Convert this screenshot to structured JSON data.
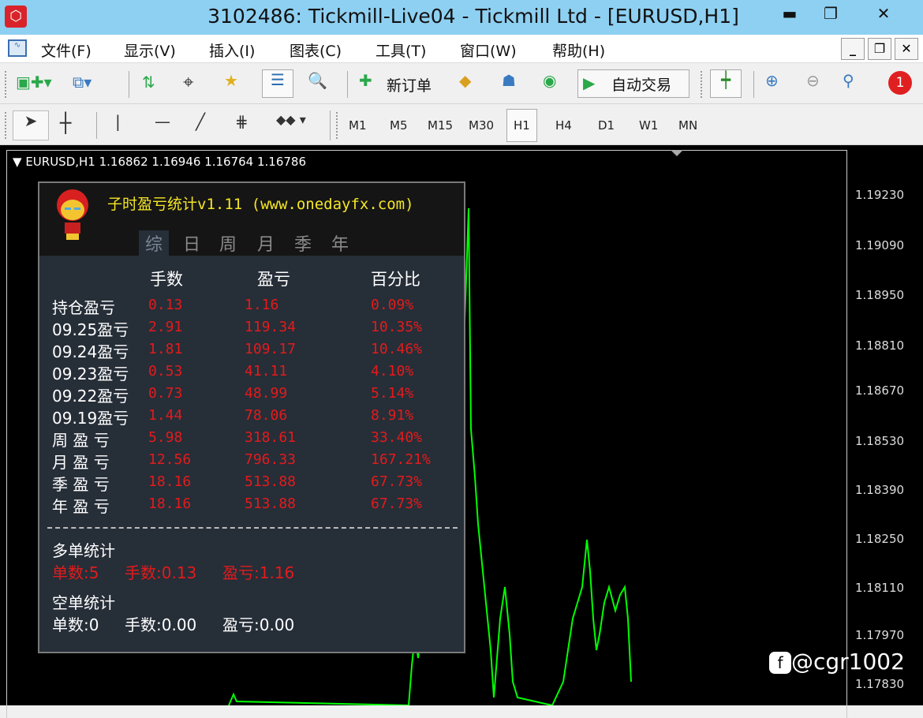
{
  "window": {
    "title": "3102486: Tickmill-Live04 - Tickmill Ltd - [EURUSD,H1]",
    "minimize": "▬",
    "maximize": "❐",
    "close": "✕"
  },
  "menu": [
    "文件(F)",
    "显示(V)",
    "插入(I)",
    "图表(C)",
    "工具(T)",
    "窗口(W)",
    "帮助(H)"
  ],
  "toolbar": {
    "new_order": "新订单",
    "auto_trading": "自动交易",
    "notification_count": "1"
  },
  "timeframes": [
    "M1",
    "M5",
    "M15",
    "M30",
    "H1",
    "H4",
    "D1",
    "W1",
    "MN"
  ],
  "active_timeframe": "H1",
  "chart": {
    "header": "EURUSD,H1  1.16862 1.16946 1.16764 1.16786",
    "price_labels": [
      "1.19230",
      "1.19090",
      "1.18950",
      "1.18810",
      "1.18670",
      "1.18530",
      "1.18390",
      "1.18250",
      "1.18110",
      "1.17970",
      "1.17830"
    ],
    "line_color": "#00ff00"
  },
  "panel": {
    "title": "子时盈亏统计v1.11 (www.onedayfx.com)",
    "tabs": [
      "综",
      "日",
      "周",
      "月",
      "季",
      "年"
    ],
    "columns": [
      "手数",
      "盈亏",
      "百分比"
    ],
    "rows": [
      {
        "label": "持仓盈亏",
        "lots": "0.13",
        "pl": "1.16",
        "pct": "0.09%"
      },
      {
        "label": "09.25盈亏",
        "lots": "2.91",
        "pl": "119.34",
        "pct": "10.35%"
      },
      {
        "label": "09.24盈亏",
        "lots": "1.81",
        "pl": "109.17",
        "pct": "10.46%"
      },
      {
        "label": "09.23盈亏",
        "lots": "0.53",
        "pl": "41.11",
        "pct": "4.10%"
      },
      {
        "label": "09.22盈亏",
        "lots": "0.73",
        "pl": "48.99",
        "pct": "5.14%"
      },
      {
        "label": "09.19盈亏",
        "lots": "1.44",
        "pl": "78.06",
        "pct": "8.91%"
      },
      {
        "label": "周 盈 亏",
        "lots": "5.98",
        "pl": "318.61",
        "pct": "33.40%"
      },
      {
        "label": "月 盈 亏",
        "lots": "12.56",
        "pl": "796.33",
        "pct": "167.21%"
      },
      {
        "label": "季 盈 亏",
        "lots": "18.16",
        "pl": "513.88",
        "pct": "67.73%"
      },
      {
        "label": "年 盈 亏",
        "lots": "18.16",
        "pl": "513.88",
        "pct": "67.73%"
      }
    ],
    "long": {
      "title": "多单统计",
      "count": "单数:5",
      "lots": "手数:0.13",
      "pl": "盈亏:1.16"
    },
    "short": {
      "title": "空单统计",
      "count": "单数:0",
      "lots": "手数:0.00",
      "pl": "盈亏:0.00"
    }
  },
  "watermark": "@cgr1002"
}
